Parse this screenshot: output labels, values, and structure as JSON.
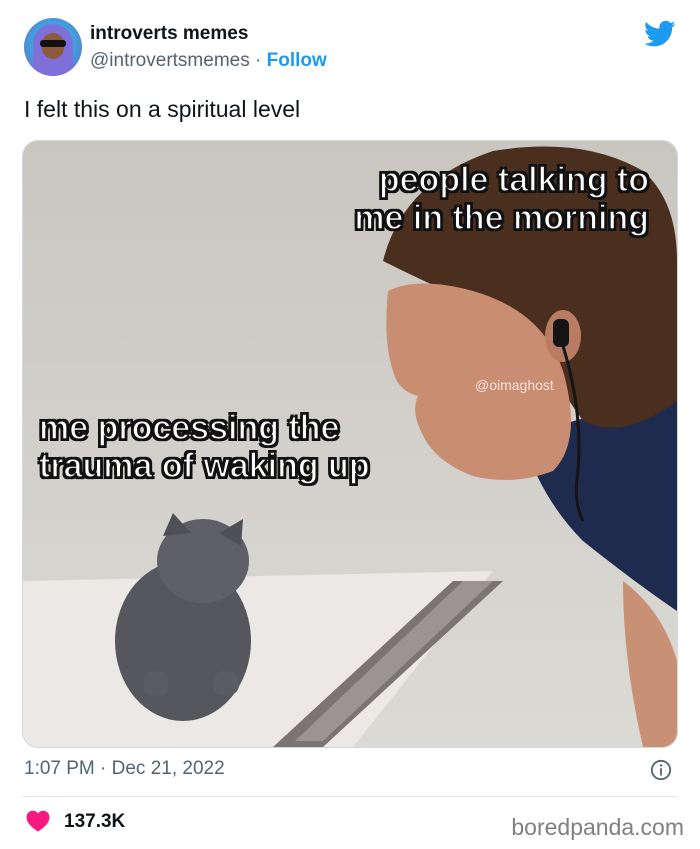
{
  "account": {
    "name": "introverts memes",
    "handle": "@introvertsmemes",
    "separator": "·",
    "follow_label": "Follow"
  },
  "tweet": {
    "text": "I felt this on a spiritual level",
    "timestamp": "1:07 PM · Dec 21, 2022",
    "likes": "137.3K"
  },
  "meme": {
    "caption_top_line1": "people talking to",
    "caption_top_line2": "me in the morning",
    "caption_bottom_line1": "me processing the",
    "caption_bottom_line2": "trauma of waking up",
    "watermark": "@oimaghost"
  },
  "footer": {
    "credit": "boredpanda.com"
  },
  "colors": {
    "twitter_blue": "#1d9bf0",
    "like_red": "#f91880",
    "muted": "#536471"
  },
  "icons": [
    "twitter-bird-icon",
    "info-icon",
    "heart-icon"
  ]
}
